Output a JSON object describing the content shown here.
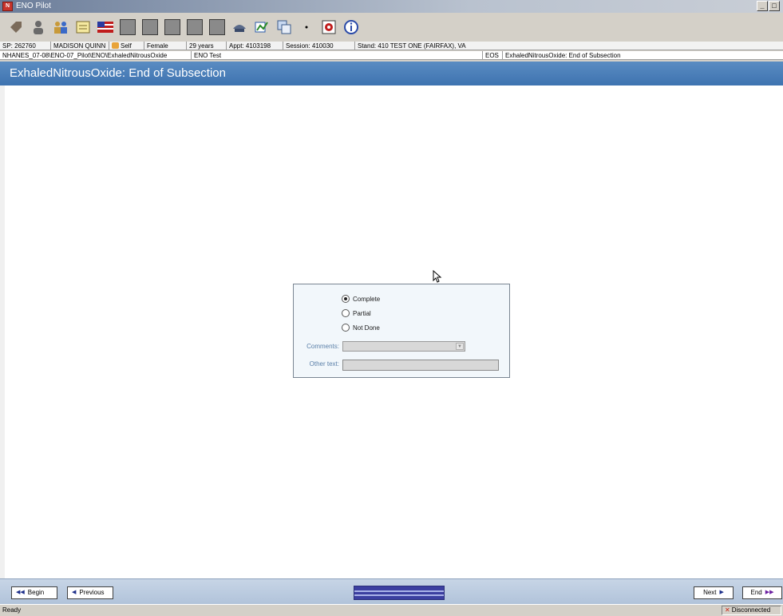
{
  "window": {
    "title": "ENO Pilot",
    "app_icon_text": "N"
  },
  "info_bar_1": {
    "sp": "SP: 262760",
    "name": "MADISON QUINN",
    "respondent": "Self",
    "gender": "Female",
    "age": "29 years",
    "appt": "Appt: 4103198",
    "session": "Session: 410030",
    "stand": "Stand: 410 TEST ONE (FAIRFAX), VA"
  },
  "info_bar_2": {
    "path": "NHANES_07-08\\ENO-07_Pilot\\ENO\\ExhaledNitrousOxide",
    "test": "ENO Test",
    "code": "EOS",
    "section": "ExhaledNitrousOxide: End of Subsection"
  },
  "header": {
    "title": "ExhaledNitrousOxide: End of Subsection"
  },
  "form": {
    "options": [
      {
        "label": "Complete",
        "checked": true
      },
      {
        "label": "Partial",
        "checked": false
      },
      {
        "label": "Not Done",
        "checked": false
      }
    ],
    "comments_label": "Comments:",
    "other_text_label": "Other text:"
  },
  "nav": {
    "begin": "Begin",
    "previous": "Previous",
    "next": "Next",
    "end": "End"
  },
  "status": {
    "left": "Ready",
    "right": "Disconnected"
  },
  "colors": {
    "header_bg": "#3e73b0",
    "nav_bg": "#b1c3da",
    "progress": "#3c3fa0"
  }
}
